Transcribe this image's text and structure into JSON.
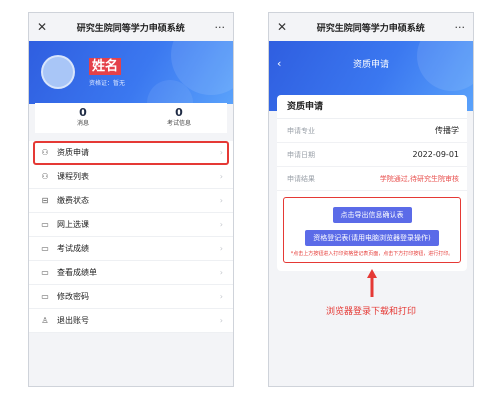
{
  "left": {
    "app_title": "研究生院同等学力申硕系统",
    "user_name": "姓名",
    "cert_text": "资格证：暂无",
    "stats": [
      {
        "num": "0",
        "label": "消息"
      },
      {
        "num": "0",
        "label": "考试信息"
      }
    ],
    "menu": [
      {
        "label": "资质申请",
        "icon": "person-badge-icon"
      },
      {
        "label": "课程列表",
        "icon": "person-badge-icon"
      },
      {
        "label": "缴费状态",
        "icon": "wallet-icon"
      },
      {
        "label": "网上选课",
        "icon": "monitor-icon"
      },
      {
        "label": "考试成绩",
        "icon": "monitor-icon"
      },
      {
        "label": "查看成绩单",
        "icon": "monitor-icon"
      },
      {
        "label": "修改密码",
        "icon": "monitor-icon"
      },
      {
        "label": "退出账号",
        "icon": "user-icon"
      }
    ]
  },
  "right": {
    "app_title": "研究生院同等学力申硕系统",
    "page_title": "资质申请",
    "card_title": "资质申请",
    "rows": [
      {
        "key": "申请专业",
        "value": "传播学"
      },
      {
        "key": "申请日期",
        "value": "2022-09-01"
      },
      {
        "key": "申请结果",
        "value": "学院通过,待研究生院审核"
      }
    ],
    "btn_export": "点击导出信息确认表",
    "btn_register": "资格登记表(请用电脑浏览器登录操作)",
    "note": "*点击上方按钮进入打印资格登记表页面，点击下方打印按钮，进行打印。",
    "caption": "浏览器登录下载和打印"
  },
  "colors": {
    "accent": "#3b78f0",
    "highlight": "#e53935",
    "button": "#5b6be8"
  }
}
